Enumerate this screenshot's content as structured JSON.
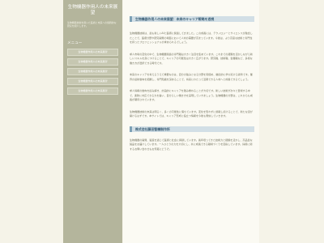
{
  "sidebar": {
    "title": "生物機器作用人の未来展望",
    "description": "生物機器技術を用いた医療と未来への挑戦的な研究を紹介します。",
    "menu_heading": "メニュー",
    "menu_items": [
      {
        "label": "生物機器作用人の未来展望"
      },
      {
        "label": "生物機器作用人の未来展望"
      },
      {
        "label": "生物機器作用人の未来展望"
      },
      {
        "label": "生物機器作用人の未来展望"
      },
      {
        "label": "生物機器作用人の未来展望"
      }
    ]
  },
  "main": {
    "heading1": "生物機器作用人の未来展望：未来のキャリア戦略を透視",
    "paragraphs1": [
      "生物機器技術は、最も新しいAIと医療に関連してきました。この成長には、テクノロジーとサイエンスが融合したことで、医療分野や研究開発の場面において人材の需要が高まっています。今後は、より高度な技術と専門性を持ったプロフェッショナルが求められるでしょう。",
      "求人市場の変化の中で、生物機器関連の専門職は大きく注目を集めています。これまでの経験を活かしながら新しいスキルを身につけることで、キャリアの可能性は大きく広がります。研究職、技術職、営業職など、多様な働き方が選択できる時代です。",
      "未来のキャリアを考えるうえで重要なのは、自分の強みとなる分野を見極め、継続的に学び続ける姿勢です。業界の最新動向を把握し、専門知識を深めることで、将来にわたって活躍できる人材へと成長できるでしょう。",
      "求人情報の動向を読み解き、計画的にキャリアを積み重ねることが大切です。新しい技術が次々と登場する中で、柔軟に対応できる力を養い、自分らしい働き方を実現していきましょう。生物機器の分野は、これからも成長が期待されています。",
      "生物機器技術の未来は明るく、多くの可能性に満ちています。変化を恐れずに挑戦し続けることで、新たな道が開けるはずです。本サイトでは、キャリア形成に役立つ情報を今後も発信していきます。"
    ],
    "heading2": "株式会社藤田智機制作所",
    "paragraphs2": [
      "生物機器の開発、製造を通じて医療と社会に貢献しています。長年培ってきた技術力と経験を活かし、高品質な製品をお届けしています。一人ひとりの力を大切にし、共に成長できる職場づくりを目指しています。採用に関するお問い合わせもお気軽にどうぞ。"
    ]
  }
}
